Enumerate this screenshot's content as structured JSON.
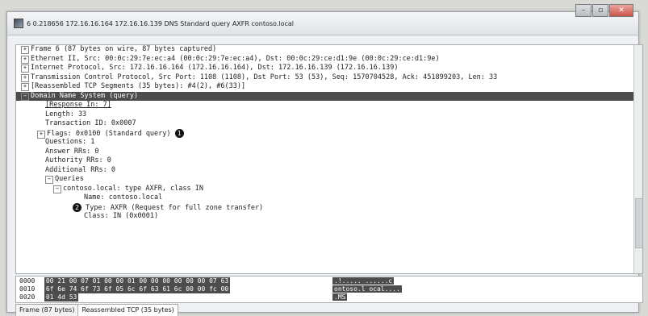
{
  "window": {
    "title": "6 0.218656 172.16.16.164 172.16.16.139 DNS Standard query AXFR contoso.local",
    "controls": [
      "–",
      "▫",
      "✕"
    ]
  },
  "packet_details": {
    "rows": [
      {
        "text": "Frame 6 (87 bytes on wire, 87 bytes captured)",
        "expander": "+"
      },
      {
        "text": "Ethernet II, Src: 00:0c:29:7e:ec:a4 (00:0c:29:7e:ec:a4), Dst: 00:0c:29:ce:d1:9e (00:0c:29:ce:d1:9e)",
        "expander": "+"
      },
      {
        "text": "Internet Protocol, Src: 172.16.16.164 (172.16.16.164), Dst: 172.16.16.139 (172.16.16.139)",
        "expander": "+"
      },
      {
        "text": "Transmission Control Protocol, Src Port: 1108 (1108), Dst Port: 53 (53), Seq: 1570704528, Ack: 451899203, Len: 33",
        "expander": "+"
      },
      {
        "text": "[Reassembled TCP Segments (35 bytes): #4(2), #6(33)]",
        "expander": "+"
      },
      {
        "text": "Domain Name System (query)",
        "expander": "−"
      },
      {
        "text": "[Response In: 7]"
      },
      {
        "text": "Length: 33"
      },
      {
        "text": "Transaction ID: 0x0007"
      },
      {
        "text": "Flags: 0x0100 (Standard query)",
        "expander": "+",
        "marker": "1"
      },
      {
        "text": "Questions: 1"
      },
      {
        "text": "Answer RRs: 0"
      },
      {
        "text": "Authority RRs: 0"
      },
      {
        "text": "Additional RRs: 0"
      },
      {
        "text": "Queries",
        "expander": "−"
      },
      {
        "text": "contoso.local: type AXFR, class IN",
        "expander": "−"
      },
      {
        "text": "Name: contoso.local"
      },
      {
        "text": "Type: AXFR (Request for full zone transfer)",
        "marker": "2"
      },
      {
        "text": "Class: IN (0x0001)"
      }
    ]
  },
  "hex_dump": [
    {
      "offset": "0000",
      "bytes": "00 21 00 07 01 00 00 01  00 00 00 00 00 00 07 63",
      "ascii": ".!..... ......c"
    },
    {
      "offset": "0010",
      "bytes": "6f 6e 74 6f 73 6f 05 6c  6f 63 61 6c 00 00 fc 00",
      "ascii": "ontoso.l ocal...."
    },
    {
      "offset": "0020",
      "bytes": "01 4d 53",
      "ascii": ".MS"
    }
  ],
  "tabs": [
    "Frame (87 bytes)",
    "Reassembled TCP (35 bytes)"
  ]
}
